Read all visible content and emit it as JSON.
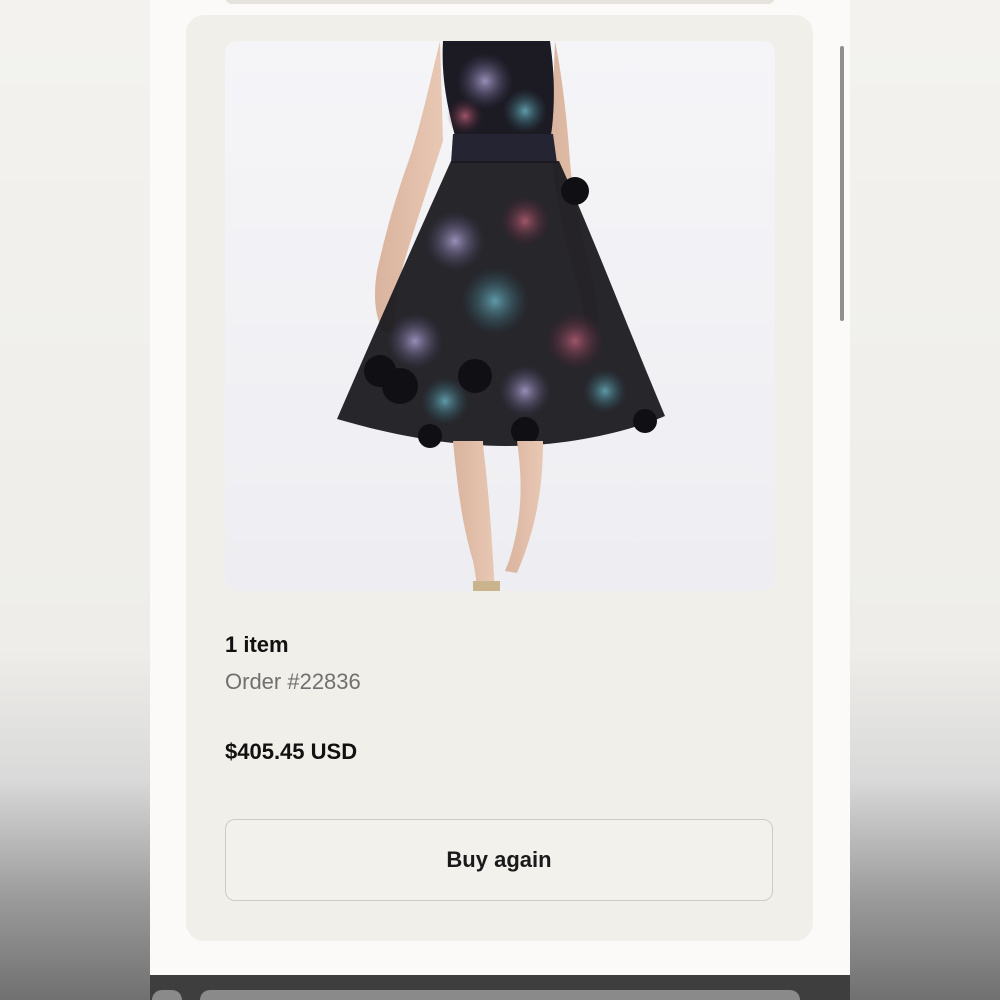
{
  "order": {
    "item_count": "1 item",
    "order_number": "Order #22836",
    "total": "$405.45 USD",
    "buy_again_label": "Buy again"
  },
  "product": {
    "image_subject": "floral organza knee-length dress"
  },
  "colors": {
    "card_background": "#f1efe9",
    "page_background": "#fbfaf8",
    "button_border": "#cfcbc2",
    "muted_text": "#707070"
  }
}
